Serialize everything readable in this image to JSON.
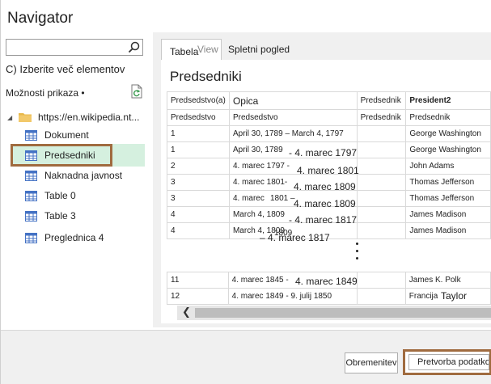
{
  "window": {
    "title": "Navigator"
  },
  "left": {
    "search_placeholder": "",
    "select_multiple": "C) Izberite več elementov",
    "display_options": "Možnosti prikaza •",
    "root": "https://en.wikipedia.nt...",
    "items": [
      {
        "label": "Dokument"
      },
      {
        "label": "Predsedniki"
      },
      {
        "label": "Naknadna javnost"
      },
      {
        "label": "Table 0"
      },
      {
        "label": "Table 3"
      },
      {
        "label": "Preglednica 4"
      }
    ]
  },
  "tabs": {
    "table_a": "Tabela",
    "table_b": "View",
    "web": "Spletni pogled"
  },
  "preview": {
    "title": "Predsedniki",
    "headers": [
      "Predsedstvo(a)",
      "Opica",
      "Predsednik",
      "President2"
    ],
    "subheaders": [
      "Predsedstvo",
      "Predsedstvo",
      "Predsednik",
      "Predsednik"
    ],
    "rows": [
      [
        "1",
        "April 30, 1789 – March 4, 1797",
        "",
        "George Washington"
      ],
      [
        "1",
        "April 30, 1789",
        "",
        "George Washington"
      ],
      [
        "2",
        "4. marec 1797 -",
        "",
        "John Adams"
      ],
      [
        "3",
        "4. marec 1801-",
        "",
        "Thomas Jefferson"
      ],
      [
        "3",
        "4. marec",
        "",
        "Thomas Jefferson"
      ],
      [
        "4",
        "March 4, 1809",
        "",
        "James Madison"
      ],
      [
        "4",
        "March 4, 1809",
        "",
        "James Madison"
      ]
    ],
    "rows_bottom": [
      [
        "11",
        "4. marec 1845 -",
        "",
        "James K. Polk"
      ],
      [
        "12",
        "4. marec 1849 - 9. julij 1850",
        "",
        "Francija"
      ]
    ],
    "overlays": {
      "r1": "- 4. marec 1797",
      "r2": "4. marec 1801",
      "r3": "4. marec 1809",
      "r4a": "1801 –",
      "r4b": "4. marec 1809",
      "r5": "- 4. marec 1817",
      "r6": "– 4. marec 1817",
      "r6b": "1809",
      "r11": "4. marec 1849",
      "r12": "Taylor"
    }
  },
  "footer": {
    "load": "Obremenitev",
    "transform": "Pretvorba podatkov"
  },
  "colors": {
    "highlight": "#a06b3f",
    "selected_bg": "#d5f0df",
    "icon_blue": "#4472c4",
    "folder": "#e8b84a"
  }
}
